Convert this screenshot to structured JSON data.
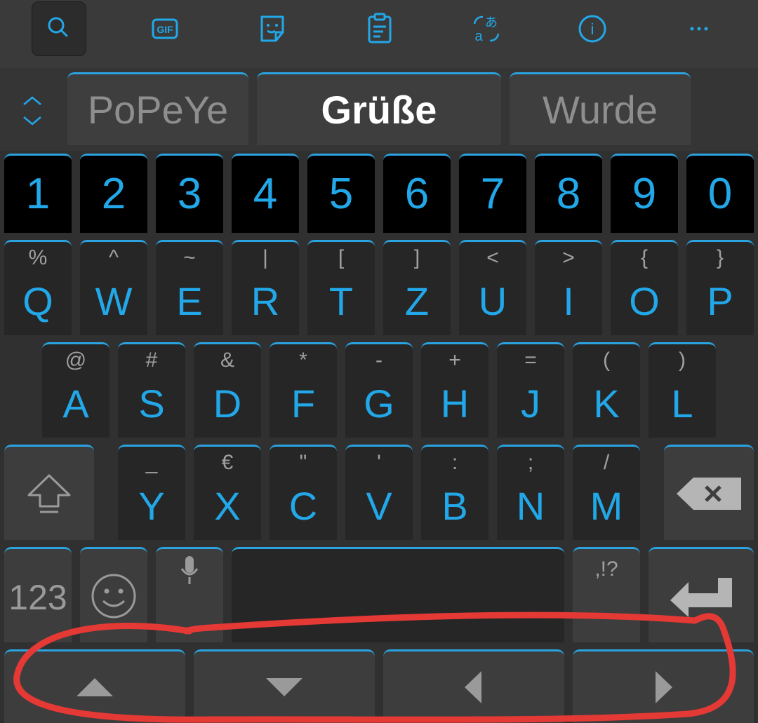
{
  "colors": {
    "accent": "#22a8e8",
    "key_bg": "#262626",
    "num_key_bg": "#000000",
    "background": "#303030",
    "annotation": "#e53935"
  },
  "toolbar": {
    "items": [
      {
        "name": "search-icon"
      },
      {
        "name": "gif-icon",
        "label": "GIF"
      },
      {
        "name": "sticker-icon"
      },
      {
        "name": "clipboard-icon"
      },
      {
        "name": "translate-icon",
        "label": "あ"
      },
      {
        "name": "info-icon",
        "label": "i"
      },
      {
        "name": "more-icon",
        "label": "⋯"
      }
    ]
  },
  "suggestions": {
    "left": "PoPeYe",
    "center": "Grüße",
    "right": "Wurde"
  },
  "number_row": [
    "1",
    "2",
    "3",
    "4",
    "5",
    "6",
    "7",
    "8",
    "9",
    "0"
  ],
  "row1": [
    {
      "main": "Q",
      "sub": "%"
    },
    {
      "main": "W",
      "sub": "^"
    },
    {
      "main": "E",
      "sub": "~"
    },
    {
      "main": "R",
      "sub": "|"
    },
    {
      "main": "T",
      "sub": "["
    },
    {
      "main": "Z",
      "sub": "]"
    },
    {
      "main": "U",
      "sub": "<"
    },
    {
      "main": "I",
      "sub": ">"
    },
    {
      "main": "O",
      "sub": "{"
    },
    {
      "main": "P",
      "sub": "}"
    }
  ],
  "row2": [
    {
      "main": "A",
      "sub": "@"
    },
    {
      "main": "S",
      "sub": "#"
    },
    {
      "main": "D",
      "sub": "&"
    },
    {
      "main": "F",
      "sub": "*"
    },
    {
      "main": "G",
      "sub": "-"
    },
    {
      "main": "H",
      "sub": "+"
    },
    {
      "main": "J",
      "sub": "="
    },
    {
      "main": "K",
      "sub": "("
    },
    {
      "main": "L",
      "sub": ")"
    }
  ],
  "row3": [
    {
      "main": "Y",
      "sub": "_"
    },
    {
      "main": "X",
      "sub": "€"
    },
    {
      "main": "C",
      "sub": "\""
    },
    {
      "main": "V",
      "sub": "'"
    },
    {
      "main": "B",
      "sub": ":"
    },
    {
      "main": "N",
      "sub": ";"
    },
    {
      "main": "M",
      "sub": "/"
    }
  ],
  "bottom_row": {
    "numbers_label": "123",
    "punct_label": ",!?"
  }
}
